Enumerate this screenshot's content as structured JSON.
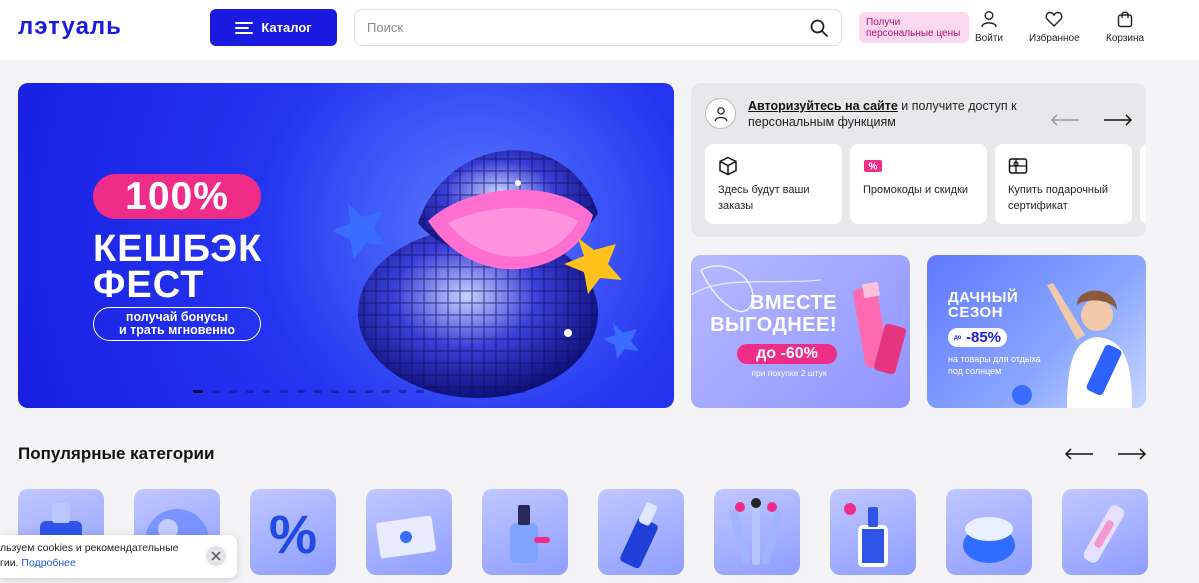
{
  "header": {
    "logo_text": "лэтуаль",
    "catalog_label": "Каталог",
    "search_placeholder": "Поиск",
    "prices_badge": "Получи персональные цены",
    "login_label": "Войти",
    "favorites_label": "Избранное",
    "cart_label": "Корзина"
  },
  "hero": {
    "cashback": "100%",
    "title_line1": "КЕШБЭК",
    "title_line2": "ФЕСТ",
    "subtitle_line1": "получай бонусы",
    "subtitle_line2": "и трать мгновенно",
    "active_slide": 1
  },
  "auth": {
    "link": "Авторизуйтесь на сайте",
    "text": " и получите доступ к персональным функциям",
    "cards": [
      {
        "label": "Здесь будут ваши заказы",
        "icon": "box-icon"
      },
      {
        "label": "Промокоды и скидки",
        "icon": "percent-tag-icon"
      },
      {
        "label": "Купить подарочный сертификат",
        "icon": "gift-card-icon"
      }
    ]
  },
  "promo1": {
    "title_line1": "ВМЕСТЕ",
    "title_line2": "ВЫГОДНЕЕ!",
    "badge": "до -60%",
    "note": "при покупке 2 штук"
  },
  "promo2": {
    "title_line1": "ДАЧНЫЙ",
    "title_line2": "СЕЗОН",
    "badge_prefix": "до",
    "badge": "-85%",
    "note_line1": "на товары для отдыха",
    "note_line2": "под солнцем"
  },
  "categories": {
    "title": "Популярные категории"
  },
  "cookie": {
    "line1": "льзуем cookies и рекомендательные",
    "line2": "гии.",
    "link": "Подробнее"
  },
  "colors": {
    "brand_blue": "#1a1ae0",
    "accent_pink": "#ef2d88"
  }
}
